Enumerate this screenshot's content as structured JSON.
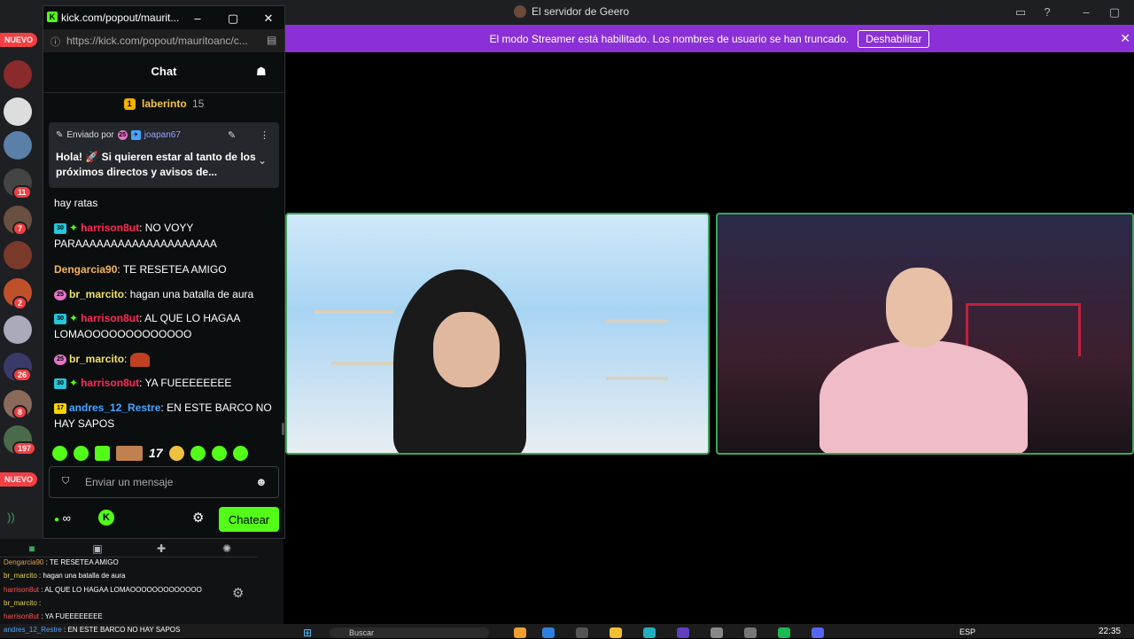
{
  "app": {
    "title": "El servidor de Geero",
    "streamer_banner": "El modo Streamer está habilitado. Los nombres de usuario se han truncado.",
    "streamer_disable": "Deshabilitar"
  },
  "guilds": {
    "nuevo_top": "NUEVO",
    "nuevo_bottom": "NUEVO",
    "badges": [
      "11",
      "7",
      "2",
      "26",
      "8",
      "197"
    ]
  },
  "kick": {
    "window_title": "kick.com/popout/maurit...",
    "url": "https://kick.com/popout/mauritoanc/c...",
    "chat_title": "Chat",
    "leaderboard": {
      "name": "laberinto",
      "count": "15",
      "badge": "1"
    },
    "pinned": {
      "label": "Enviado por",
      "user": "joapan67",
      "badge": "25",
      "text": "Hola! 🚀 Si quieren estar al tanto de los próximos directos y avisos de..."
    },
    "messages": [
      {
        "text": "hay ratas"
      },
      {
        "badge": "30",
        "user": "harrison8ut",
        "color": "#ff2a55",
        "text": "NO VOYY PARAAAAAAAAAAAAAAAAAAAA"
      },
      {
        "user": "Dengarcia90",
        "color": "#f5b45a",
        "text": "TE RESETEA AMIGO"
      },
      {
        "badge": "25",
        "user": "br_marcito",
        "color": "#f0e06a",
        "text": "hagan una batalla de aura"
      },
      {
        "badge": "30",
        "user": "harrison8ut",
        "color": "#ff2a55",
        "text": "AL QUE LO HAGAA LOMAOOOOOOOOOOOOO"
      },
      {
        "badge": "25",
        "user": "br_marcito",
        "color": "#f0e06a",
        "text": ""
      },
      {
        "badge": "30",
        "user": "harrison8ut",
        "color": "#ff2a55",
        "text": "YA FUEEEEEEEE"
      },
      {
        "badge": "17",
        "user": "andres_12_Restre",
        "color": "#4aa3ff",
        "text": "EN ESTE BARCO NO HAY SAPOS"
      }
    ],
    "emote_count": "17",
    "input_placeholder": "Enviar un mensaje",
    "send_label": "Chatear",
    "infinity": "∞"
  },
  "dock_chat": [
    {
      "user": "Dengarcia90",
      "text": "TE RESETEA AMIGO",
      "cls": "u1"
    },
    {
      "user": "br_marcito",
      "text": "hagan una batalla de aura",
      "cls": "u2"
    },
    {
      "user": "harrison8ut",
      "text": "AL QUE LO HAGAA LOMAOOOOOOOOOOOOO",
      "cls": "u3"
    },
    {
      "user": "br_marcito",
      "text": "",
      "cls": "u2"
    },
    {
      "user": "harrison8ut",
      "text": "YA FUEEEEEEEE",
      "cls": "u3"
    },
    {
      "user": "andres_12_Restre",
      "text": "EN ESTE BARCO NO HAY SAPOS",
      "cls": "u4"
    }
  ],
  "taskbar": {
    "search": "Buscar",
    "lang": "ESP",
    "clock": "22:35"
  },
  "colors": {
    "kick_green": "#53fc18",
    "streamer_purple": "#8b30d6",
    "tile_border": "#3ba55c"
  }
}
